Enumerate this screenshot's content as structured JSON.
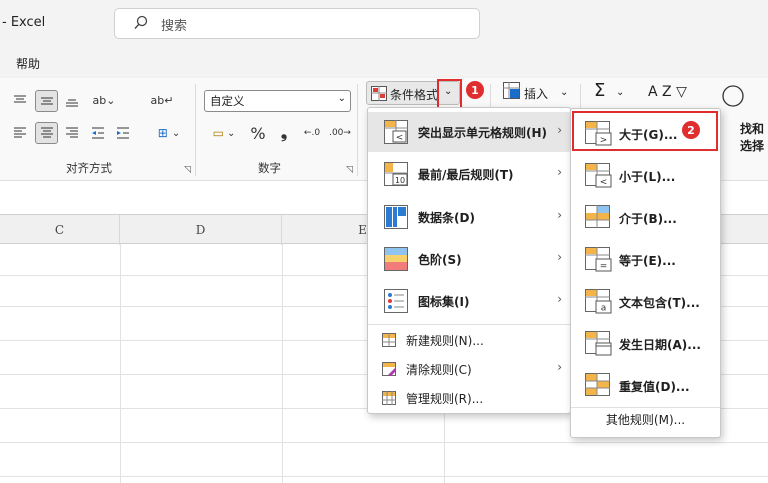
{
  "app": {
    "title": "- Excel",
    "search_placeholder": "搜索"
  },
  "menubar": {
    "help_tab": "帮助"
  },
  "ribbon": {
    "alignment_group_label": "对齐方式",
    "number_group_label": "数字",
    "number_format_value": "自定义",
    "percent_symbol": "%",
    "comma_symbol": "❟",
    "conditional_formatting_label": "条件格式",
    "insert_label": "插入",
    "sum_symbol": "Σ",
    "find_select_label": "找和选择",
    "sort_letters": "A Z"
  },
  "badges": {
    "step1": "1",
    "step2": "2"
  },
  "sheet": {
    "columns": [
      "C",
      "D",
      "E"
    ]
  },
  "cf_menu": {
    "items": [
      {
        "label": "突出显示单元格规则(H)",
        "icon": "highlight-cells-icon",
        "has_submenu": true
      },
      {
        "label": "最前/最后规则(T)",
        "icon": "top-bottom-icon",
        "has_submenu": true
      },
      {
        "label": "数据条(D)",
        "icon": "data-bars-icon",
        "has_submenu": true
      },
      {
        "label": "色阶(S)",
        "icon": "color-scales-icon",
        "has_submenu": true
      },
      {
        "label": "图标集(I)",
        "icon": "icon-sets-icon",
        "has_submenu": true
      }
    ],
    "small_items": [
      {
        "label": "新建规则(N)...",
        "icon": "new-rule-icon"
      },
      {
        "label": "清除规则(C)",
        "icon": "clear-rules-icon",
        "has_submenu": true
      },
      {
        "label": "管理规则(R)...",
        "icon": "manage-rules-icon"
      }
    ]
  },
  "sub_menu": {
    "items": [
      {
        "label": "大于(G)...",
        "icon": "greater-than-icon",
        "glyph": ">"
      },
      {
        "label": "小于(L)...",
        "icon": "less-than-icon",
        "glyph": "<"
      },
      {
        "label": "介于(B)...",
        "icon": "between-icon",
        "glyph": ""
      },
      {
        "label": "等于(E)...",
        "icon": "equal-to-icon",
        "glyph": "="
      },
      {
        "label": "文本包含(T)...",
        "icon": "text-contains-icon",
        "glyph": "a"
      },
      {
        "label": "发生日期(A)...",
        "icon": "date-occurring-icon",
        "glyph": ""
      },
      {
        "label": "重复值(D)...",
        "icon": "duplicate-values-icon",
        "glyph": ""
      }
    ],
    "more_rules": "其他规则(M)..."
  },
  "colors": {
    "accent_red": "#e02d2d",
    "highlight_bg": "#e6e6e6"
  }
}
